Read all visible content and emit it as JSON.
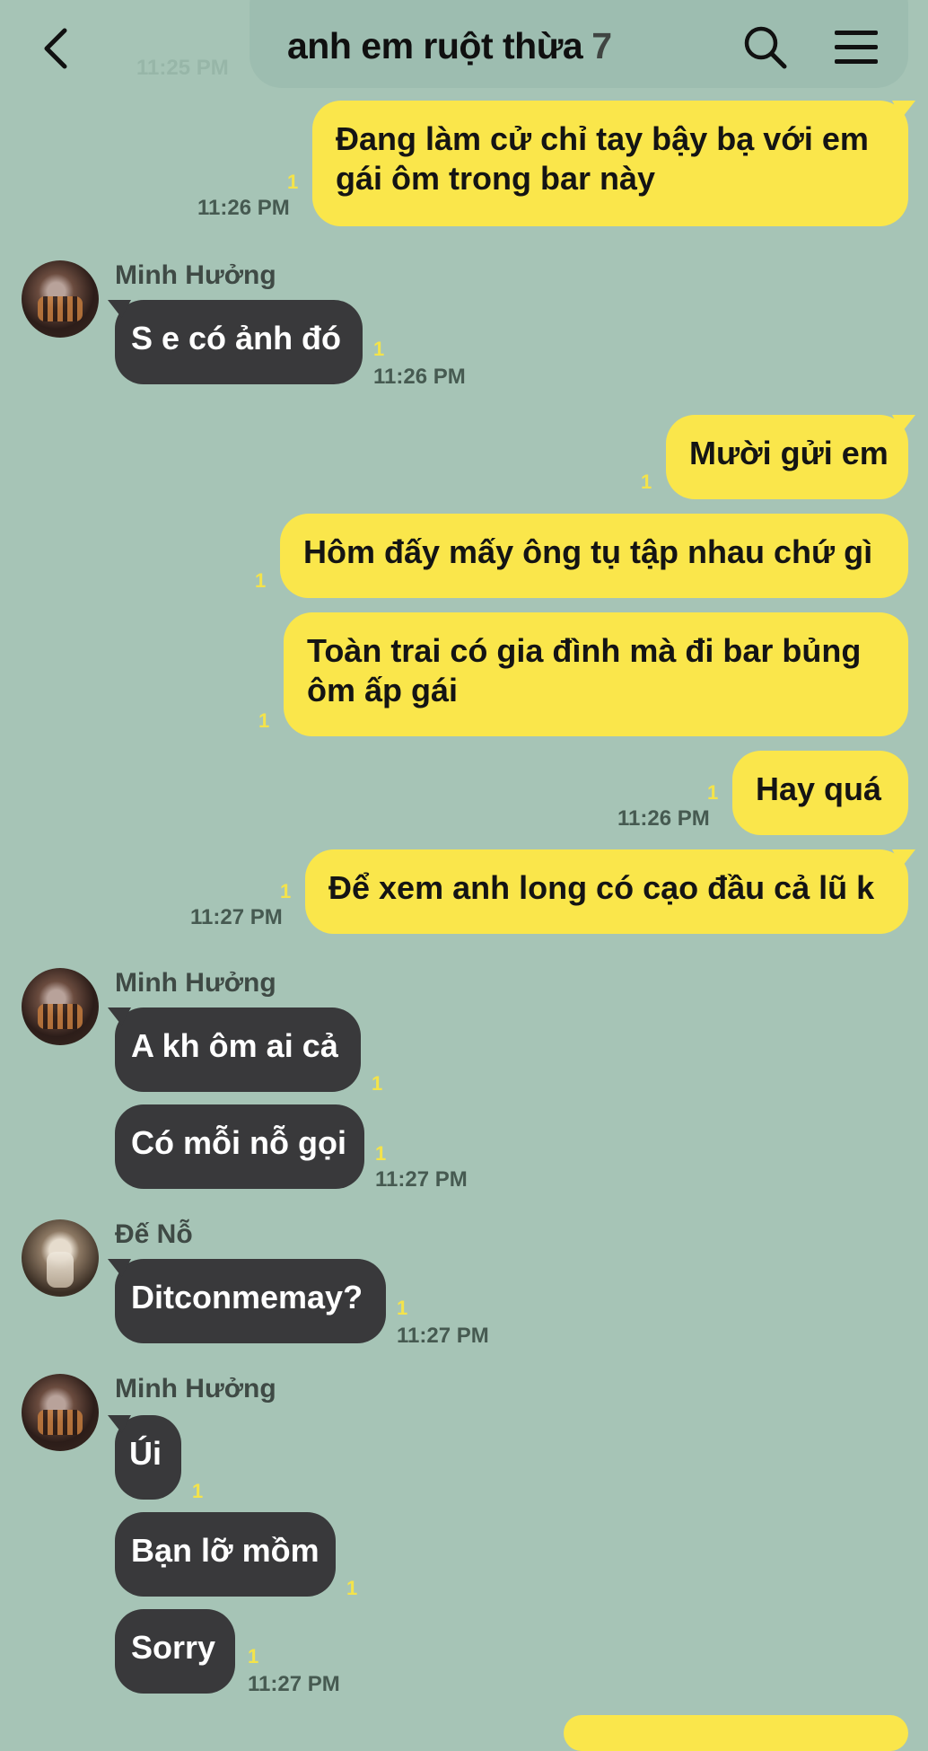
{
  "header": {
    "title": "anh em ruột thừa",
    "member_count": "7",
    "background_time": "11:25 PM"
  },
  "messages": [
    {
      "sender_side": "out",
      "text_lines": [
        "Đang làm cử chỉ tay bậy bạ với em",
        "gái ôm trong bar này"
      ],
      "unread": "1",
      "time": "11:26 PM"
    },
    {
      "sender_side": "in",
      "sender": "Minh Hưởng",
      "text": "S e có ảnh đó",
      "unread": "1",
      "time": "11:26 PM"
    },
    {
      "sender_side": "out",
      "text": "Mười gửi em",
      "unread": "1"
    },
    {
      "sender_side": "out",
      "text": "Hôm đấy mấy ông tụ tập nhau chứ gì",
      "unread": "1"
    },
    {
      "sender_side": "out",
      "text_lines": [
        "Toàn trai có gia đình mà đi bar bủng",
        "ôm ấp gái"
      ],
      "unread": "1"
    },
    {
      "sender_side": "out",
      "text": "Hay quá",
      "unread": "1",
      "time": "11:26 PM"
    },
    {
      "sender_side": "out",
      "text": "Để xem anh long có cạo đầu cả lũ k",
      "unread": "1",
      "time": "11:27 PM"
    },
    {
      "sender_side": "in",
      "sender": "Minh Hưởng",
      "text": "A kh ôm ai cả",
      "unread": "1"
    },
    {
      "sender_side": "in",
      "text": "Có mỗi nỗ gọi",
      "unread": "1",
      "time": "11:27 PM"
    },
    {
      "sender_side": "in",
      "sender": "Đế Nỗ",
      "text": "Ditconmemay?",
      "unread": "1",
      "time": "11:27 PM"
    },
    {
      "sender_side": "in",
      "sender": "Minh Hưởng",
      "text": "Úi",
      "unread": "1"
    },
    {
      "sender_side": "in",
      "text": "Bạn lỡ mồm",
      "unread": "1"
    },
    {
      "sender_side": "in",
      "text": "Sorry",
      "unread": "1",
      "time": "11:27 PM"
    }
  ],
  "colors": {
    "background": "#a6c4b6",
    "outgoing_bubble": "#fae64b",
    "incoming_bubble": "#39393b",
    "unread_count": "#f4e34a"
  }
}
